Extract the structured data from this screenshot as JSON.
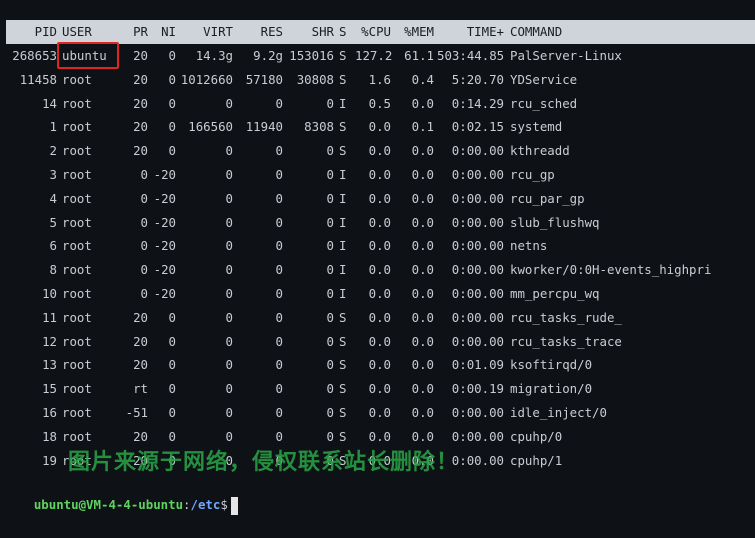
{
  "header": [
    "PID",
    "USER",
    "PR",
    "NI",
    "VIRT",
    "RES",
    "SHR",
    "S",
    "%CPU",
    "%MEM",
    "TIME+",
    "COMMAND"
  ],
  "rows": [
    [
      "268653",
      "ubuntu",
      "20",
      "0",
      "14.3g",
      "9.2g",
      "153016",
      "S",
      "127.2",
      "61.1",
      "503:44.85",
      "PalServer-Linux"
    ],
    [
      "11458",
      "root",
      "20",
      "0",
      "1012660",
      "57180",
      "30808",
      "S",
      "1.6",
      "0.4",
      "5:20.70",
      "YDService"
    ],
    [
      "14",
      "root",
      "20",
      "0",
      "0",
      "0",
      "0",
      "I",
      "0.5",
      "0.0",
      "0:14.29",
      "rcu_sched"
    ],
    [
      "1",
      "root",
      "20",
      "0",
      "166560",
      "11940",
      "8308",
      "S",
      "0.0",
      "0.1",
      "0:02.15",
      "systemd"
    ],
    [
      "2",
      "root",
      "20",
      "0",
      "0",
      "0",
      "0",
      "S",
      "0.0",
      "0.0",
      "0:00.00",
      "kthreadd"
    ],
    [
      "3",
      "root",
      "0",
      "-20",
      "0",
      "0",
      "0",
      "I",
      "0.0",
      "0.0",
      "0:00.00",
      "rcu_gp"
    ],
    [
      "4",
      "root",
      "0",
      "-20",
      "0",
      "0",
      "0",
      "I",
      "0.0",
      "0.0",
      "0:00.00",
      "rcu_par_gp"
    ],
    [
      "5",
      "root",
      "0",
      "-20",
      "0",
      "0",
      "0",
      "I",
      "0.0",
      "0.0",
      "0:00.00",
      "slub_flushwq"
    ],
    [
      "6",
      "root",
      "0",
      "-20",
      "0",
      "0",
      "0",
      "I",
      "0.0",
      "0.0",
      "0:00.00",
      "netns"
    ],
    [
      "8",
      "root",
      "0",
      "-20",
      "0",
      "0",
      "0",
      "I",
      "0.0",
      "0.0",
      "0:00.00",
      "kworker/0:0H-events_highpri"
    ],
    [
      "10",
      "root",
      "0",
      "-20",
      "0",
      "0",
      "0",
      "I",
      "0.0",
      "0.0",
      "0:00.00",
      "mm_percpu_wq"
    ],
    [
      "11",
      "root",
      "20",
      "0",
      "0",
      "0",
      "0",
      "S",
      "0.0",
      "0.0",
      "0:00.00",
      "rcu_tasks_rude_"
    ],
    [
      "12",
      "root",
      "20",
      "0",
      "0",
      "0",
      "0",
      "S",
      "0.0",
      "0.0",
      "0:00.00",
      "rcu_tasks_trace"
    ],
    [
      "13",
      "root",
      "20",
      "0",
      "0",
      "0",
      "0",
      "S",
      "0.0",
      "0.0",
      "0:01.09",
      "ksoftirqd/0"
    ],
    [
      "15",
      "root",
      "rt",
      "0",
      "0",
      "0",
      "0",
      "S",
      "0.0",
      "0.0",
      "0:00.19",
      "migration/0"
    ],
    [
      "16",
      "root",
      "-51",
      "0",
      "0",
      "0",
      "0",
      "S",
      "0.0",
      "0.0",
      "0:00.00",
      "idle_inject/0"
    ],
    [
      "18",
      "root",
      "20",
      "0",
      "0",
      "0",
      "0",
      "S",
      "0.0",
      "0.0",
      "0:00.00",
      "cpuhp/0"
    ],
    [
      "19",
      "root",
      "20",
      "0",
      "0",
      "0",
      "0",
      "S",
      "0.0",
      "0.0",
      "0:00.00",
      "cpuhp/1"
    ]
  ],
  "prompt": {
    "user_host": "ubuntu@VM-4-4-ubuntu",
    "sep": ":",
    "path": "/etc",
    "symbol": "$"
  },
  "watermark": "图片来源于网络，侵权联系站长删除！",
  "colors": {
    "background": "#0e1116",
    "header_bg": "#cfd3da",
    "highlight_border": "#e02424",
    "prompt_user": "#5fd35f",
    "prompt_path": "#6fa8ff"
  }
}
